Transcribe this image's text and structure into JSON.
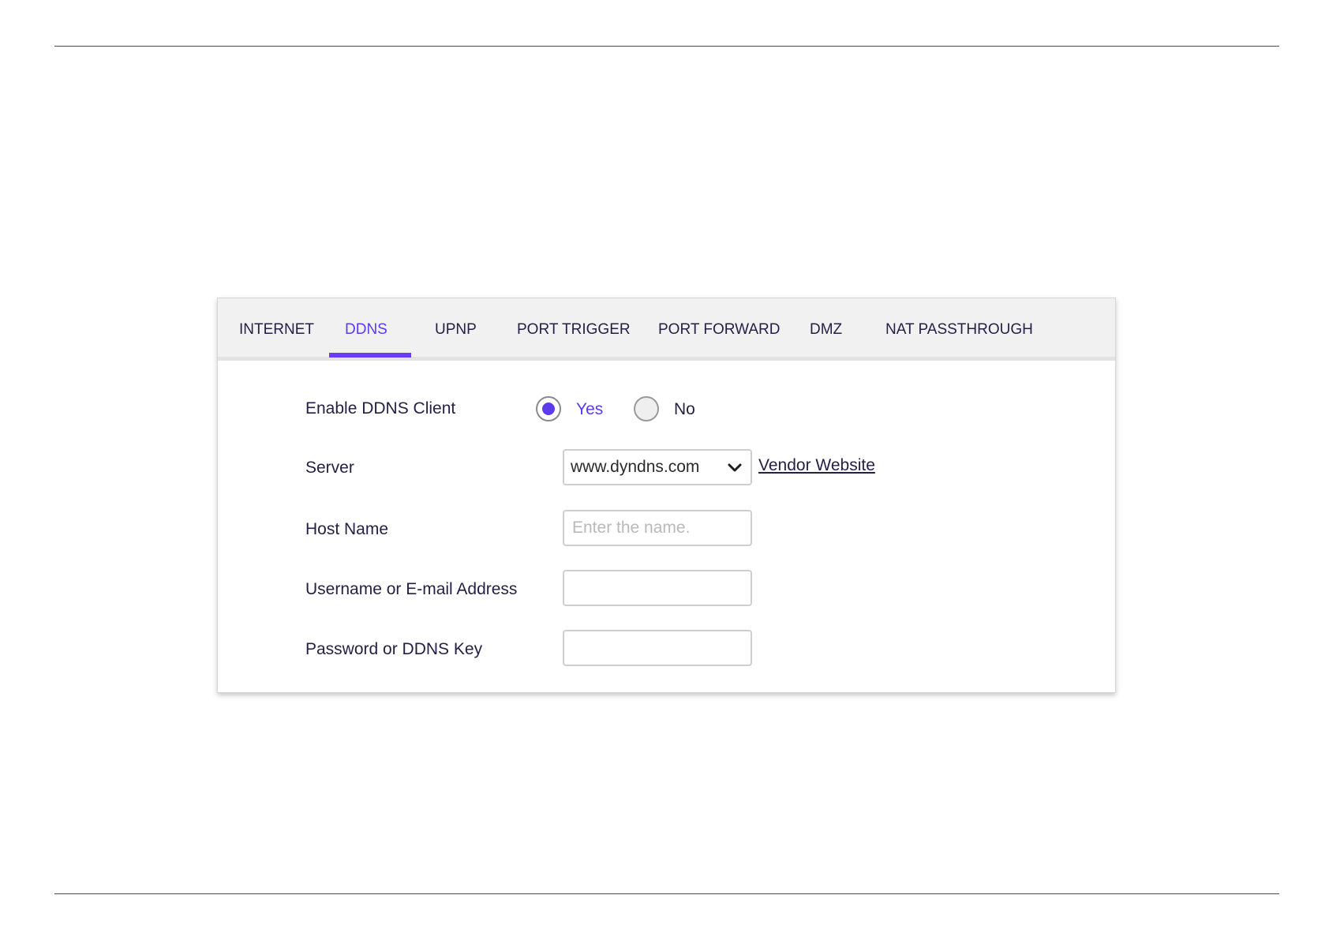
{
  "tabs": {
    "internet": "INTERNET",
    "ddns": "DDNS",
    "upnp": "UPNP",
    "port_trigger": "PORT TRIGGER",
    "port_forward": "PORT FORWARD",
    "dmz": "DMZ",
    "nat_passthrough": "NAT PASSTHROUGH",
    "active": "DDNS"
  },
  "form": {
    "enable_label": "Enable DDNS Client",
    "enable_options": {
      "yes": "Yes",
      "no": "No",
      "selected": "Yes"
    },
    "server_label": "Server",
    "server_value": "www.dyndns.com",
    "vendor_link": "Vendor Website",
    "host_label": "Host Name",
    "host_placeholder": "Enter the name.",
    "host_value": "",
    "username_label": "Username or E-mail Address",
    "username_value": "",
    "password_label": "Password or DDNS Key",
    "password_value": ""
  },
  "icons": {
    "select_arrow": "chevron-down-icon"
  },
  "colors": {
    "accent": "#5b3bec",
    "underline": "#6a3df0",
    "text": "#231f45",
    "tabbar_bg": "#f1f1f1"
  }
}
